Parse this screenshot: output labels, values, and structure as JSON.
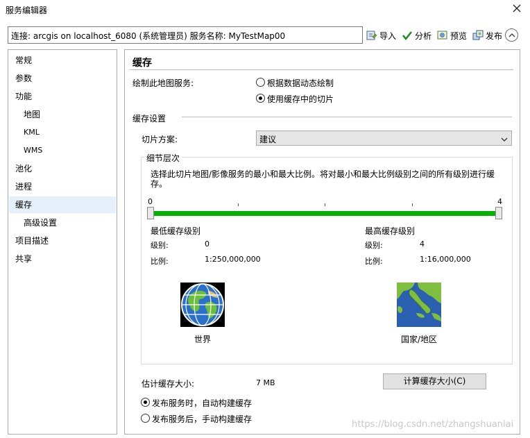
{
  "window": {
    "title": "服务编辑器"
  },
  "connection": {
    "text": "连接: arcgis on localhost_6080 (系统管理员)   服务名称: MyTestMap00"
  },
  "toolbar": {
    "import_label": "导入",
    "analyze_label": "分析",
    "preview_label": "预览",
    "publish_label": "发布"
  },
  "sidebar": {
    "items": [
      {
        "label": "常规"
      },
      {
        "label": "参数"
      },
      {
        "label": "功能"
      },
      {
        "label": "地图"
      },
      {
        "label": "KML"
      },
      {
        "label": "WMS"
      },
      {
        "label": "池化"
      },
      {
        "label": "进程"
      },
      {
        "label": "缓存"
      },
      {
        "label": "高级设置"
      },
      {
        "label": "项目描述"
      },
      {
        "label": "共享"
      }
    ],
    "selected": "缓存"
  },
  "main": {
    "heading": "缓存",
    "draw_label": "绘制此地图服务:",
    "radio_dynamic": "根据数据动态绘制",
    "radio_cache": "使用缓存中的切片",
    "draw_selected": "cache",
    "cache_settings": "缓存设置",
    "tiling_label": "切片方案:",
    "tiling_value": "建议",
    "lod": {
      "title": "细节层次",
      "desc": "选择此切片地图/影像服务的最小和最大比例。将对最小和最大比例级别之间的所有级别进行缓存。",
      "slider_min": "0",
      "slider_max": "4",
      "min_title": "最低缓存级别",
      "max_title": "最高缓存级别",
      "level_label": "级别:",
      "scale_label": "比例:",
      "min_level": "0",
      "min_scale": "1:250,000,000",
      "max_level": "4",
      "max_scale": "1:16,000,000",
      "world_caption": "世界",
      "country_caption": "国家/地区"
    },
    "estimate_label": "估计缓存大小:",
    "estimate_value": "7 MB",
    "calc_button": "计算缓存大小(C)",
    "build_auto": "发布服务时，自动构建缓存",
    "build_manual": "发布服务后，手动构建缓存",
    "build_selected": "auto"
  },
  "watermark": "https://blog.csdn.net/zhangshuanlai"
}
